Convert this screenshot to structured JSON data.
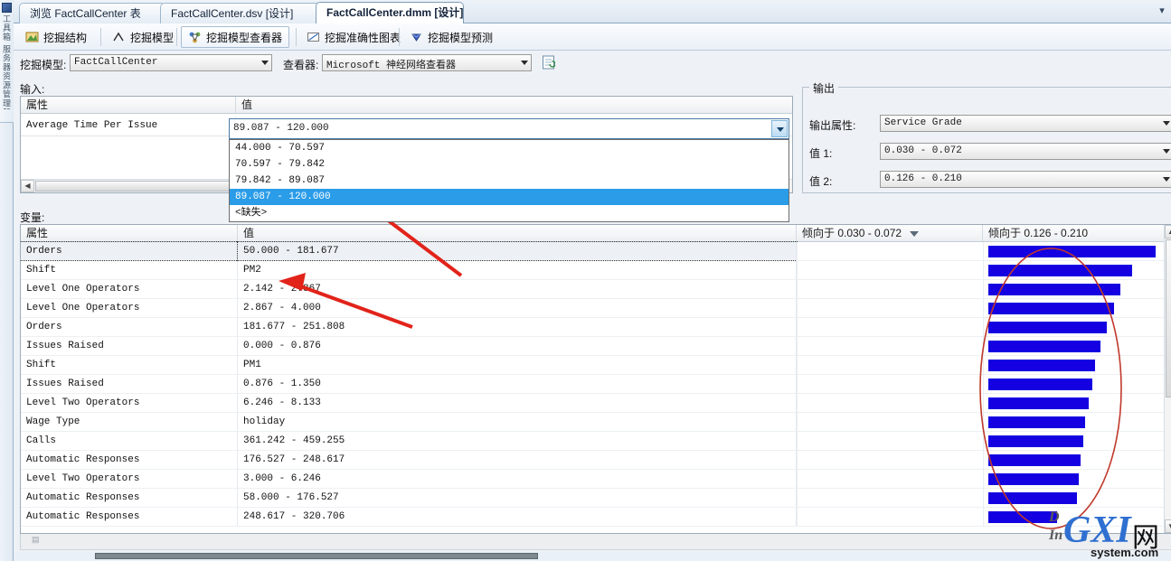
{
  "window": {
    "tabs": [
      {
        "label": "浏览 FactCallCenter 表",
        "active": false
      },
      {
        "label": "FactCallCenter.dsv [设计]",
        "active": false
      },
      {
        "label": "FactCallCenter.dmm [设计]",
        "active": true
      }
    ],
    "tab_close_icon": "▾"
  },
  "toolbox": {
    "label": "工具箱 服务器资源管理器"
  },
  "viewbar": {
    "items": [
      {
        "label": "挖掘结构",
        "icon": "mining-structure-icon",
        "selected": false
      },
      {
        "label": "挖掘模型",
        "icon": "mining-model-icon",
        "selected": false
      },
      {
        "label": "挖掘模型查看器",
        "icon": "mining-model-viewer-icon",
        "selected": true
      },
      {
        "label": "挖掘准确性图表",
        "icon": "accuracy-chart-icon",
        "selected": false
      },
      {
        "label": "挖掘模型预测",
        "icon": "model-prediction-icon",
        "selected": false
      }
    ]
  },
  "modelrow": {
    "model_label": "挖掘模型:",
    "model_value": "FactCallCenter",
    "viewer_label": "查看器:",
    "viewer_value": "Microsoft 神经网络查看器",
    "refresh_icon": "refresh-viewer-icon"
  },
  "input": {
    "title": "输入:",
    "columns": [
      "属性",
      "值"
    ],
    "rows": [
      {
        "attribute": "Average Time Per Issue",
        "value": "89.087 - 120.000"
      }
    ],
    "dropdown_open": true,
    "dropdown_options": [
      "44.000 - 70.597",
      "70.597 - 79.842",
      "79.842 - 89.087",
      "89.087 - 120.000",
      "<缺失>"
    ],
    "dropdown_selected_index": 3
  },
  "output": {
    "title": "输出",
    "attribute_label": "输出属性:",
    "attribute_value": "Service Grade",
    "value1_label": "值 1:",
    "value1_value": "0.030 - 0.072",
    "value2_label": "值 2:",
    "value2_value": "0.126 - 0.210"
  },
  "variables": {
    "title": "变量:",
    "columns": [
      "属性",
      "值",
      "倾向于 0.030 - 0.072",
      "倾向于 0.126 - 0.210"
    ],
    "sort_indicator_icon": "sort-descending-icon",
    "rows": [
      {
        "attribute": "Orders",
        "value": "50.000 - 181.677",
        "bar1": 0,
        "bar2": 100
      },
      {
        "attribute": "Shift",
        "value": "PM2",
        "bar1": 0,
        "bar2": 86
      },
      {
        "attribute": "Level One Operators",
        "value": "2.142 - 2.867",
        "bar1": 0,
        "bar2": 79
      },
      {
        "attribute": "Level One Operators",
        "value": "2.867 - 4.000",
        "bar1": 0,
        "bar2": 75
      },
      {
        "attribute": "Orders",
        "value": "181.677 - 251.808",
        "bar1": 0,
        "bar2": 71
      },
      {
        "attribute": "Issues Raised",
        "value": "0.000 - 0.876",
        "bar1": 0,
        "bar2": 67
      },
      {
        "attribute": "Shift",
        "value": "PM1",
        "bar1": 0,
        "bar2": 64
      },
      {
        "attribute": "Issues Raised",
        "value": "0.876 - 1.350",
        "bar1": 0,
        "bar2": 62
      },
      {
        "attribute": "Level Two Operators",
        "value": "6.246 - 8.133",
        "bar1": 0,
        "bar2": 60
      },
      {
        "attribute": "Wage Type",
        "value": "holiday",
        "bar1": 0,
        "bar2": 58
      },
      {
        "attribute": "Calls",
        "value": "361.242 - 459.255",
        "bar1": 0,
        "bar2": 57
      },
      {
        "attribute": "Automatic Responses",
        "value": "176.527 - 248.617",
        "bar1": 0,
        "bar2": 55
      },
      {
        "attribute": "Level Two Operators",
        "value": "3.000 - 6.246",
        "bar1": 0,
        "bar2": 54
      },
      {
        "attribute": "Automatic Responses",
        "value": "58.000 - 176.527",
        "bar1": 0,
        "bar2": 53
      },
      {
        "attribute": "Automatic Responses",
        "value": "248.617 - 320.706",
        "bar1": 0,
        "bar2": 41
      }
    ]
  },
  "chart_data": {
    "type": "bar",
    "title": "倾向于 0.126 - 0.210",
    "xlabel": "",
    "ylabel": "属性",
    "categories": [
      "Orders 50.000 - 181.677",
      "Shift PM2",
      "Level One Operators 2.142 - 2.867",
      "Level One Operators 2.867 - 4.000",
      "Orders 181.677 - 251.808",
      "Issues Raised 0.000 - 0.876",
      "Shift PM1",
      "Issues Raised 0.876 - 1.350",
      "Level Two Operators 6.246 - 8.133",
      "Wage Type holiday",
      "Calls 361.242 - 459.255",
      "Automatic Responses 176.527 - 248.617",
      "Level Two Operators 3.000 - 6.246",
      "Automatic Responses 58.000 - 176.527",
      "Automatic Responses 248.617 - 320.706"
    ],
    "series": [
      {
        "name": "倾向于 0.030 - 0.072",
        "values": [
          0,
          0,
          0,
          0,
          0,
          0,
          0,
          0,
          0,
          0,
          0,
          0,
          0,
          0,
          0
        ]
      },
      {
        "name": "倾向于 0.126 - 0.210",
        "values": [
          100,
          86,
          79,
          75,
          71,
          67,
          64,
          62,
          60,
          58,
          57,
          55,
          54,
          53,
          41
        ]
      }
    ],
    "bar_color": "#1400e0",
    "ylim": [
      0,
      100
    ],
    "grid": false,
    "legend": "none"
  },
  "annotations": {
    "arrow_color": "#e2231a",
    "ellipse_color": "#c0392b",
    "arrow1_name": "arrow-to-selected-option",
    "arrow2_name": "arrow-to-shift-pm2-row",
    "ellipse_name": "highlight-ellipse-bars"
  },
  "watermark": {
    "main": "GXI",
    "cn": "网",
    "sub": "system.com",
    "left1": "D",
    "left2": "In"
  },
  "colors": {
    "bar": "#1400e0",
    "selection": "#2a9ce8",
    "accent": "#e2231a",
    "panel": "#eef2f7"
  }
}
